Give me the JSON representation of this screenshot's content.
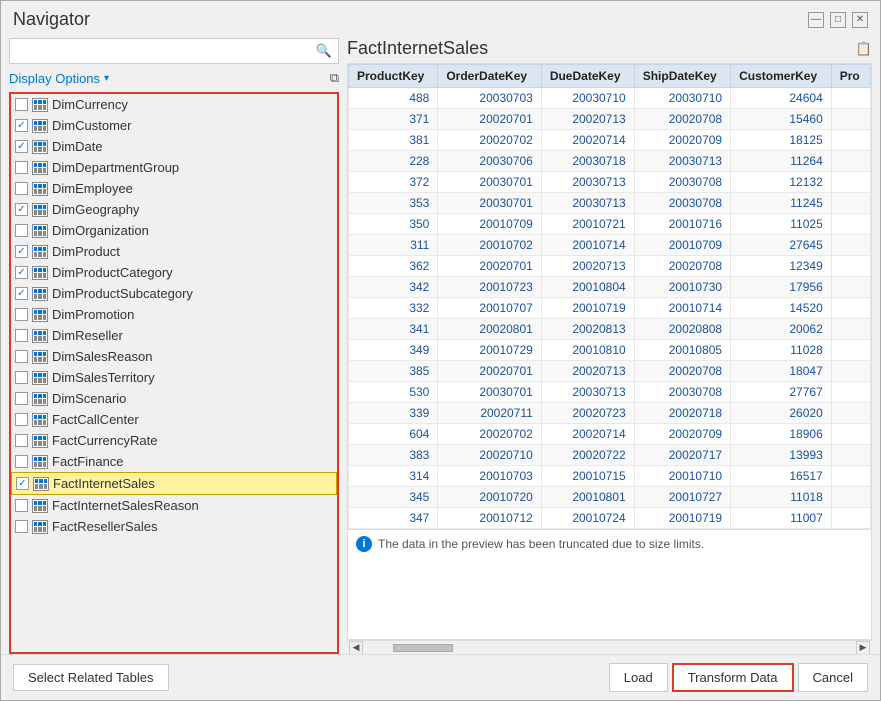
{
  "window": {
    "title": "Navigator"
  },
  "titlebar": {
    "minimize_label": "—",
    "maximize_label": "□",
    "close_label": "✕"
  },
  "left_panel": {
    "search_placeholder": "",
    "display_options_label": "Display Options",
    "display_options_arrow": "▾",
    "items": [
      {
        "name": "DimCurrency",
        "checked": false,
        "partial": true
      },
      {
        "name": "DimCustomer",
        "checked": true
      },
      {
        "name": "DimDate",
        "checked": true
      },
      {
        "name": "DimDepartmentGroup",
        "checked": false
      },
      {
        "name": "DimEmployee",
        "checked": false
      },
      {
        "name": "DimGeography",
        "checked": true
      },
      {
        "name": "DimOrganization",
        "checked": false
      },
      {
        "name": "DimProduct",
        "checked": true
      },
      {
        "name": "DimProductCategory",
        "checked": true
      },
      {
        "name": "DimProductSubcategory",
        "checked": true
      },
      {
        "name": "DimPromotion",
        "checked": false
      },
      {
        "name": "DimReseller",
        "checked": false
      },
      {
        "name": "DimSalesReason",
        "checked": false
      },
      {
        "name": "DimSalesTerritory",
        "checked": false
      },
      {
        "name": "DimScenario",
        "checked": false
      },
      {
        "name": "FactCallCenter",
        "checked": false
      },
      {
        "name": "FactCurrencyRate",
        "checked": false
      },
      {
        "name": "FactFinance",
        "checked": false
      },
      {
        "name": "FactInternetSales",
        "checked": true,
        "selected": true
      },
      {
        "name": "FactInternetSalesReason",
        "checked": false
      },
      {
        "name": "FactResellerSales",
        "checked": false
      }
    ]
  },
  "right_panel": {
    "title": "FactInternetSales",
    "columns": [
      "ProductKey",
      "OrderDateKey",
      "DueDateKey",
      "ShipDateKey",
      "CustomerKey",
      "Pro"
    ],
    "rows": [
      [
        488,
        20030703,
        20030710,
        20030710,
        24604,
        ""
      ],
      [
        371,
        20020701,
        20020713,
        20020708,
        15460,
        ""
      ],
      [
        381,
        20020702,
        20020714,
        20020709,
        18125,
        ""
      ],
      [
        228,
        20030706,
        20030718,
        20030713,
        11264,
        ""
      ],
      [
        372,
        20030701,
        20030713,
        20030708,
        12132,
        ""
      ],
      [
        353,
        20030701,
        20030713,
        20030708,
        11245,
        ""
      ],
      [
        350,
        20010709,
        20010721,
        20010716,
        11025,
        ""
      ],
      [
        311,
        20010702,
        20010714,
        20010709,
        27645,
        ""
      ],
      [
        362,
        20020701,
        20020713,
        20020708,
        12349,
        ""
      ],
      [
        342,
        20010723,
        20010804,
        20010730,
        17956,
        ""
      ],
      [
        332,
        20010707,
        20010719,
        20010714,
        14520,
        ""
      ],
      [
        341,
        20020801,
        20020813,
        20020808,
        20062,
        ""
      ],
      [
        349,
        20010729,
        20010810,
        20010805,
        11028,
        ""
      ],
      [
        385,
        20020701,
        20020713,
        20020708,
        18047,
        ""
      ],
      [
        530,
        20030701,
        20030713,
        20030708,
        27767,
        ""
      ],
      [
        339,
        20020711,
        20020723,
        20020718,
        26020,
        ""
      ],
      [
        604,
        20020702,
        20020714,
        20020709,
        18906,
        ""
      ],
      [
        383,
        20020710,
        20020722,
        20020717,
        13993,
        ""
      ],
      [
        314,
        20010703,
        20010715,
        20010710,
        16517,
        ""
      ],
      [
        345,
        20010720,
        20010801,
        20010727,
        11018,
        ""
      ],
      [
        347,
        20010712,
        20010724,
        20010719,
        11007,
        ""
      ]
    ],
    "truncated_notice": "The data in the preview has been truncated due to size limits."
  },
  "bottom_bar": {
    "select_related_tables_label": "Select Related Tables",
    "load_label": "Load",
    "transform_data_label": "Transform Data",
    "cancel_label": "Cancel"
  }
}
